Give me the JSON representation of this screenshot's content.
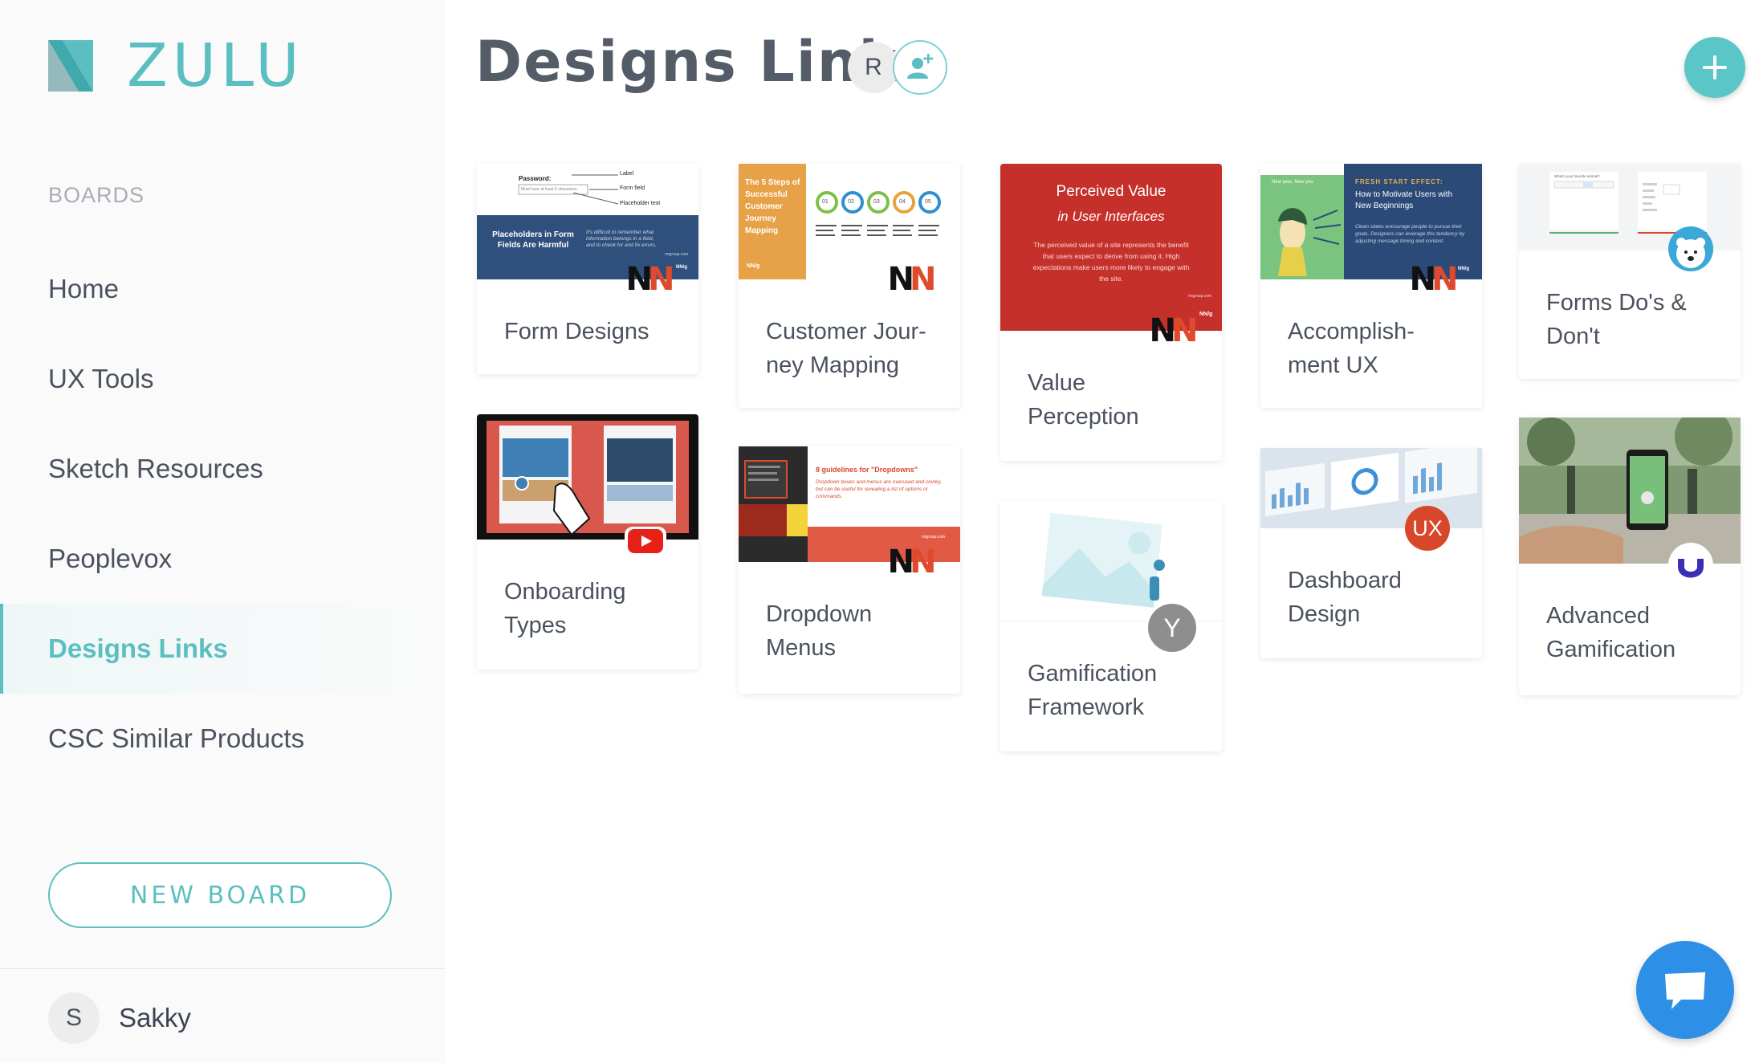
{
  "app": {
    "name": "ZULU",
    "brand_color": "#5bbfc2"
  },
  "sidebar": {
    "section_label": "BOARDS",
    "items": [
      {
        "label": "Home",
        "active": false
      },
      {
        "label": "UX Tools",
        "active": false
      },
      {
        "label": "Sketch Resources",
        "active": false
      },
      {
        "label": "Peoplevox",
        "active": false
      },
      {
        "label": "Designs Links",
        "active": true
      },
      {
        "label": "CSC Similar Products",
        "active": false
      }
    ],
    "new_board_label": "NEW BOARD",
    "user": {
      "initial": "S",
      "name": "Sakky"
    }
  },
  "header": {
    "title": "Designs Links",
    "member_initial": "R",
    "add_member_icon": "add-user-icon",
    "add_icon": "plus-icon"
  },
  "cards": {
    "form_designs": {
      "title": "Form Designs",
      "thumb": {
        "field_label": "Password:",
        "field_hint": "Must have at least 6 characters",
        "ann_label": "Label",
        "ann_field": "Form field",
        "ann_placeholder": "Placeholder text",
        "banner_title": "Placeholders in Form Fields Are Harmful",
        "banner_note": "It's difficult to remember what information belongs in a field, and to check for and fix errors.",
        "source": "nngroup.com",
        "brand": "NN/g"
      },
      "badge": "nn"
    },
    "customer_journey": {
      "title": "Customer Jour-ney Mapping",
      "thumb": {
        "heading": "The 5 Steps of Successful Customer Journey Mapping",
        "brand": "NN/g",
        "steps": [
          "01",
          "02",
          "03",
          "04",
          "05"
        ]
      },
      "badge": "nn"
    },
    "value_perception": {
      "title": "Value Perception",
      "thumb": {
        "heading1": "Perceived Value",
        "heading2": "in User Interfaces",
        "body": "The perceived value of a site represents the benefit that users expect to derive from using it. High expectations make users more likely to engage with the site.",
        "source": "nngroup.com",
        "brand": "NN/g"
      },
      "badge": "nn"
    },
    "accomplishment_ux": {
      "title": "Accomplish-ment UX",
      "thumb": {
        "side_label": "New year, New you",
        "heading": "FRESH START EFFECT:",
        "subheading": "How to Motivate Users with New Beginnings",
        "body": "Clean slates encourage people to pursue their goals. Designers can leverage this tendency by adjusting message timing and content.",
        "brand": "NN/g"
      },
      "badge": "nn"
    },
    "forms_dos": {
      "title": "Forms Do's & Don't",
      "thumb": {
        "question": "What's your favorite animal?"
      },
      "badge": "bear-avatar-icon"
    },
    "onboarding": {
      "title": "Onboarding Types",
      "badge": "youtube-icon"
    },
    "dropdown": {
      "title": "Dropdown Menus",
      "thumb": {
        "heading": "8 guidelines for \"Dropdowns\"",
        "body": "Dropdown boxes and menus are overused and clunky, but can be useful for revealing a list of options or commands.",
        "source": "nngroup.com"
      },
      "badge": "nn"
    },
    "dashboard": {
      "title": "Dashboard Design",
      "badge_text": "UX"
    },
    "advanced_gamification": {
      "title": "Advanced Gamification",
      "badge": "u-logo-icon"
    },
    "gamification_framework": {
      "title": "Gamification Framework",
      "badge_text": "Y"
    }
  },
  "chat": {
    "icon": "chat-bubble-icon",
    "color": "#2d8fe6"
  }
}
